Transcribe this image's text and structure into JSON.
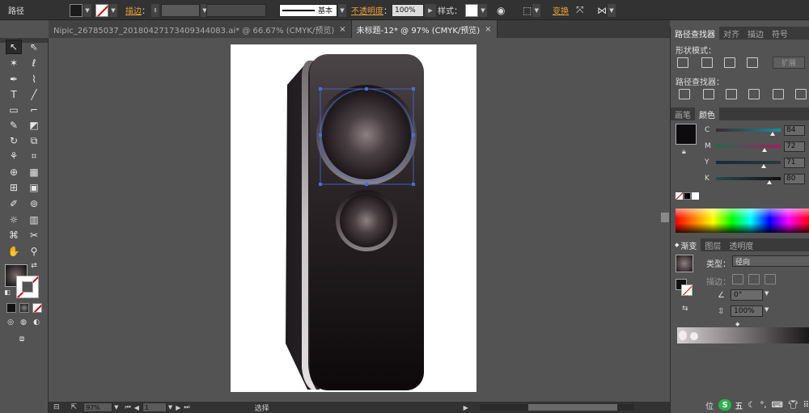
{
  "control_bar": {
    "object_type": "路径",
    "stroke_label": "描边",
    "stroke_profile": "基本",
    "opacity_label": "不透明度",
    "opacity_value": "100%",
    "style_label": "样式",
    "transform_label": "变换"
  },
  "tabs": [
    {
      "label": "Nipic_26785037_20180427173409344083.ai* @ 66.67% (CMYK/预览)",
      "active": false
    },
    {
      "label": "未标题-12* @ 97% (CMYK/预览)",
      "active": true
    }
  ],
  "status_bar": {
    "zoom": "97%",
    "page": "1",
    "tool_status": "选择"
  },
  "pathfinder_panel": {
    "tabs": [
      "路径查找器",
      "对齐",
      "描边",
      "符号"
    ],
    "shape_modes_label": "形状模式：",
    "expand_button": "扩展",
    "pathfinders_label": "路径查找器："
  },
  "color_panel": {
    "tabs": [
      "画笔",
      "颜色"
    ],
    "channels": [
      {
        "name": "C",
        "value": "84",
        "fraction": 0.84,
        "color": "#1f8a9a"
      },
      {
        "name": "M",
        "value": "72",
        "fraction": 0.72,
        "color": "#a02060"
      },
      {
        "name": "Y",
        "value": "71",
        "fraction": 0.71,
        "color": "#b8a020"
      },
      {
        "name": "K",
        "value": "80",
        "fraction": 0.8,
        "color": "#111111"
      }
    ]
  },
  "gradient_panel": {
    "tabs": [
      "渐变",
      "图层",
      "透明度"
    ],
    "type_label": "类型：",
    "type_value": "径向",
    "stroke_label": "描边：",
    "angle_value": "0°",
    "aspect_value": "100%"
  },
  "ime_bar": {
    "lang": "五"
  },
  "dock_partial_label": "位"
}
